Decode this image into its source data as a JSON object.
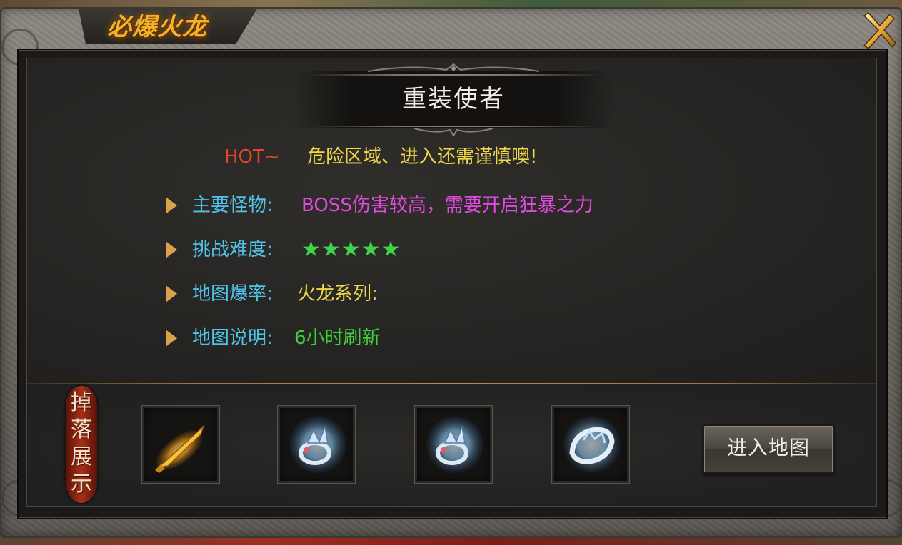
{
  "window": {
    "title": "必爆火龙"
  },
  "boss": {
    "name": "重装使者"
  },
  "hot": {
    "tag": "HOT~",
    "message": "危险区域、进入还需谨慎噢!"
  },
  "info": [
    {
      "label": "主要怪物:",
      "value": "BOSS伤害较高，需要开启狂暴之力",
      "color": "#e04adf"
    },
    {
      "label": "挑战难度:",
      "value": "★★★★★",
      "color": "#3fd24a",
      "rating": 5
    },
    {
      "label": "地图爆率:",
      "value": "火龙系列:",
      "color": "#f0d84a"
    },
    {
      "label": "地图说明:",
      "value": "6小时刷新",
      "color": "#3fcf3a"
    }
  ],
  "drops": {
    "label": "掉落展示",
    "items": [
      {
        "icon": "flame-blade-icon"
      },
      {
        "icon": "silver-ring-icon"
      },
      {
        "icon": "silver-ring-icon"
      },
      {
        "icon": "silver-bracelet-icon"
      }
    ]
  },
  "actions": {
    "enter_map_label": "进入地图"
  },
  "colors": {
    "label": "#4fc3e8",
    "hot_tag": "#e0452a",
    "hot_message": "#f0d84a",
    "title_gold": "#f2b32a",
    "bullet": "#d8a24a"
  }
}
